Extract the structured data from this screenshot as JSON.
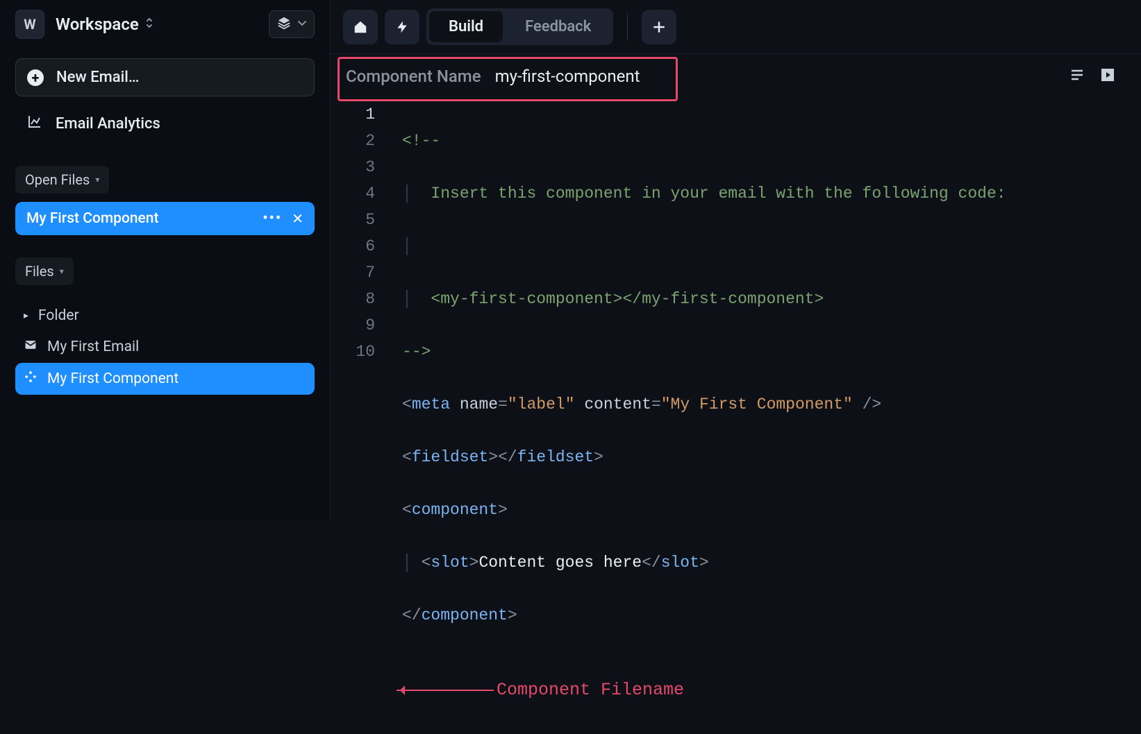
{
  "workspace": {
    "badge": "W",
    "name": "Workspace"
  },
  "sidebar": {
    "new_email": "New Email…",
    "analytics": "Email Analytics",
    "open_files_header": "Open Files",
    "files_header": "Files",
    "open_file": "My First Component",
    "tree": {
      "folder": "Folder",
      "email": "My First Email",
      "component": "My First Component"
    }
  },
  "topbar": {
    "tabs": {
      "build": "Build",
      "feedback": "Feedback"
    }
  },
  "component_bar": {
    "label": "Component Name",
    "value": "my-first-component"
  },
  "editor": {
    "lines": [
      "1",
      "2",
      "3",
      "4",
      "5",
      "6",
      "7",
      "8",
      "9",
      "10"
    ],
    "l1": "<!--",
    "l2": "  Insert this component in your email with the following code:",
    "l3": "",
    "l4": "  <my-first-component></my-first-component>",
    "l5": "-->",
    "l6_tag": "meta",
    "l6_attr1": "name",
    "l6_val1": "\"label\"",
    "l6_attr2": "content",
    "l6_val2": "\"My First Component\"",
    "l7_tag": "fieldset",
    "l8_tag": "component",
    "l9_tag": "slot",
    "l9_text": "Content goes here",
    "l10_tag": "component"
  },
  "annotation": "Component Filename",
  "colors": {
    "accent": "#1f8fff",
    "highlight": "#e54868"
  }
}
